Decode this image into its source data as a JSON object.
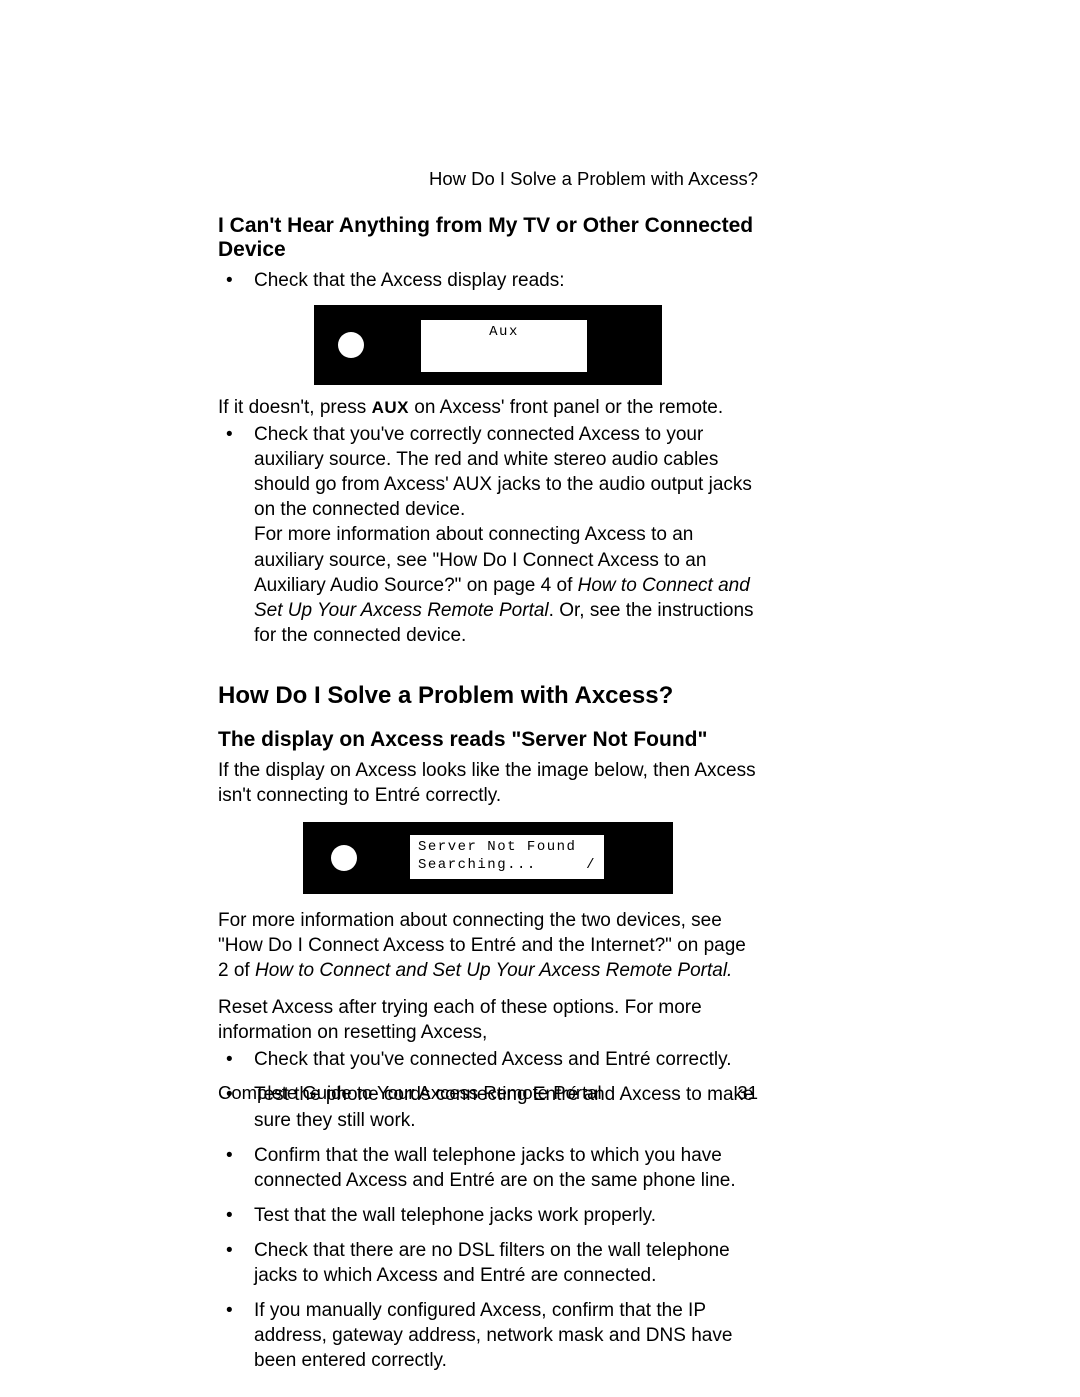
{
  "running_head": "How Do I Solve a Problem with Axcess?",
  "section_a": {
    "heading": "I Can't Hear Anything from My TV or Other Connected Device",
    "bullet1": "Check that the Axcess display reads:",
    "panel1_text": "Aux",
    "after_panel_pre": "If it doesn't, press ",
    "after_panel_aux": "AUX",
    "after_panel_post": " on Axcess' front panel or the remote.",
    "bullet2_l1": "Check that you've correctly connected Axcess to your auxiliary source. The red and white stereo audio cables should go from Axcess' AUX jacks to the audio output jacks on the connected device.",
    "bullet2_l2_pre": "For more information about connecting Axcess to an auxiliary source, see \"How Do I Connect Axcess to an Auxiliary Audio Source?\" on page 4 of ",
    "bullet2_l2_em": "How to Connect and Set Up Your Axcess Remote Portal",
    "bullet2_l2_post": ". Or, see the instructions for the connected device."
  },
  "section_b": {
    "heading": "How Do I Solve a Problem with Axcess?",
    "subheading": "The display on Axcess reads \"Server Not Found\"",
    "intro": "If the display on Axcess looks like the image below, then Axcess isn't connecting to Entré correctly.",
    "panel_line1": "Server Not Found",
    "panel_line2_a": "Searching...",
    "panel_line2_b": "/",
    "after_panel_pre": "For more information about connecting the two devices, see \"How Do I Connect Axcess to Entré and the Internet?\" on page 2 of ",
    "after_panel_em": "How to Connect and Set Up Your Axcess Remote Portal.",
    "reset": "Reset Axcess after trying each of these options. For more information on resetting Axcess,",
    "bullets": [
      "Check that you've connected Axcess and Entré correctly.",
      "Test the phone cords connecting Entré and Axcess to make sure they still work.",
      "Confirm that the wall telephone jacks to which you have connected Axcess and Entré are on the same phone line.",
      "Test that the wall telephone jacks work properly.",
      "Check that there are no DSL filters on the wall telephone jacks to which Axcess and Entré are connected.",
      "If you manually configured Axcess, confirm that the IP address, gateway address, network mask and DNS have been entered correctly."
    ]
  },
  "footer": {
    "title": "Complete Guide to Your Axcess Remote Portal",
    "page": "31"
  }
}
